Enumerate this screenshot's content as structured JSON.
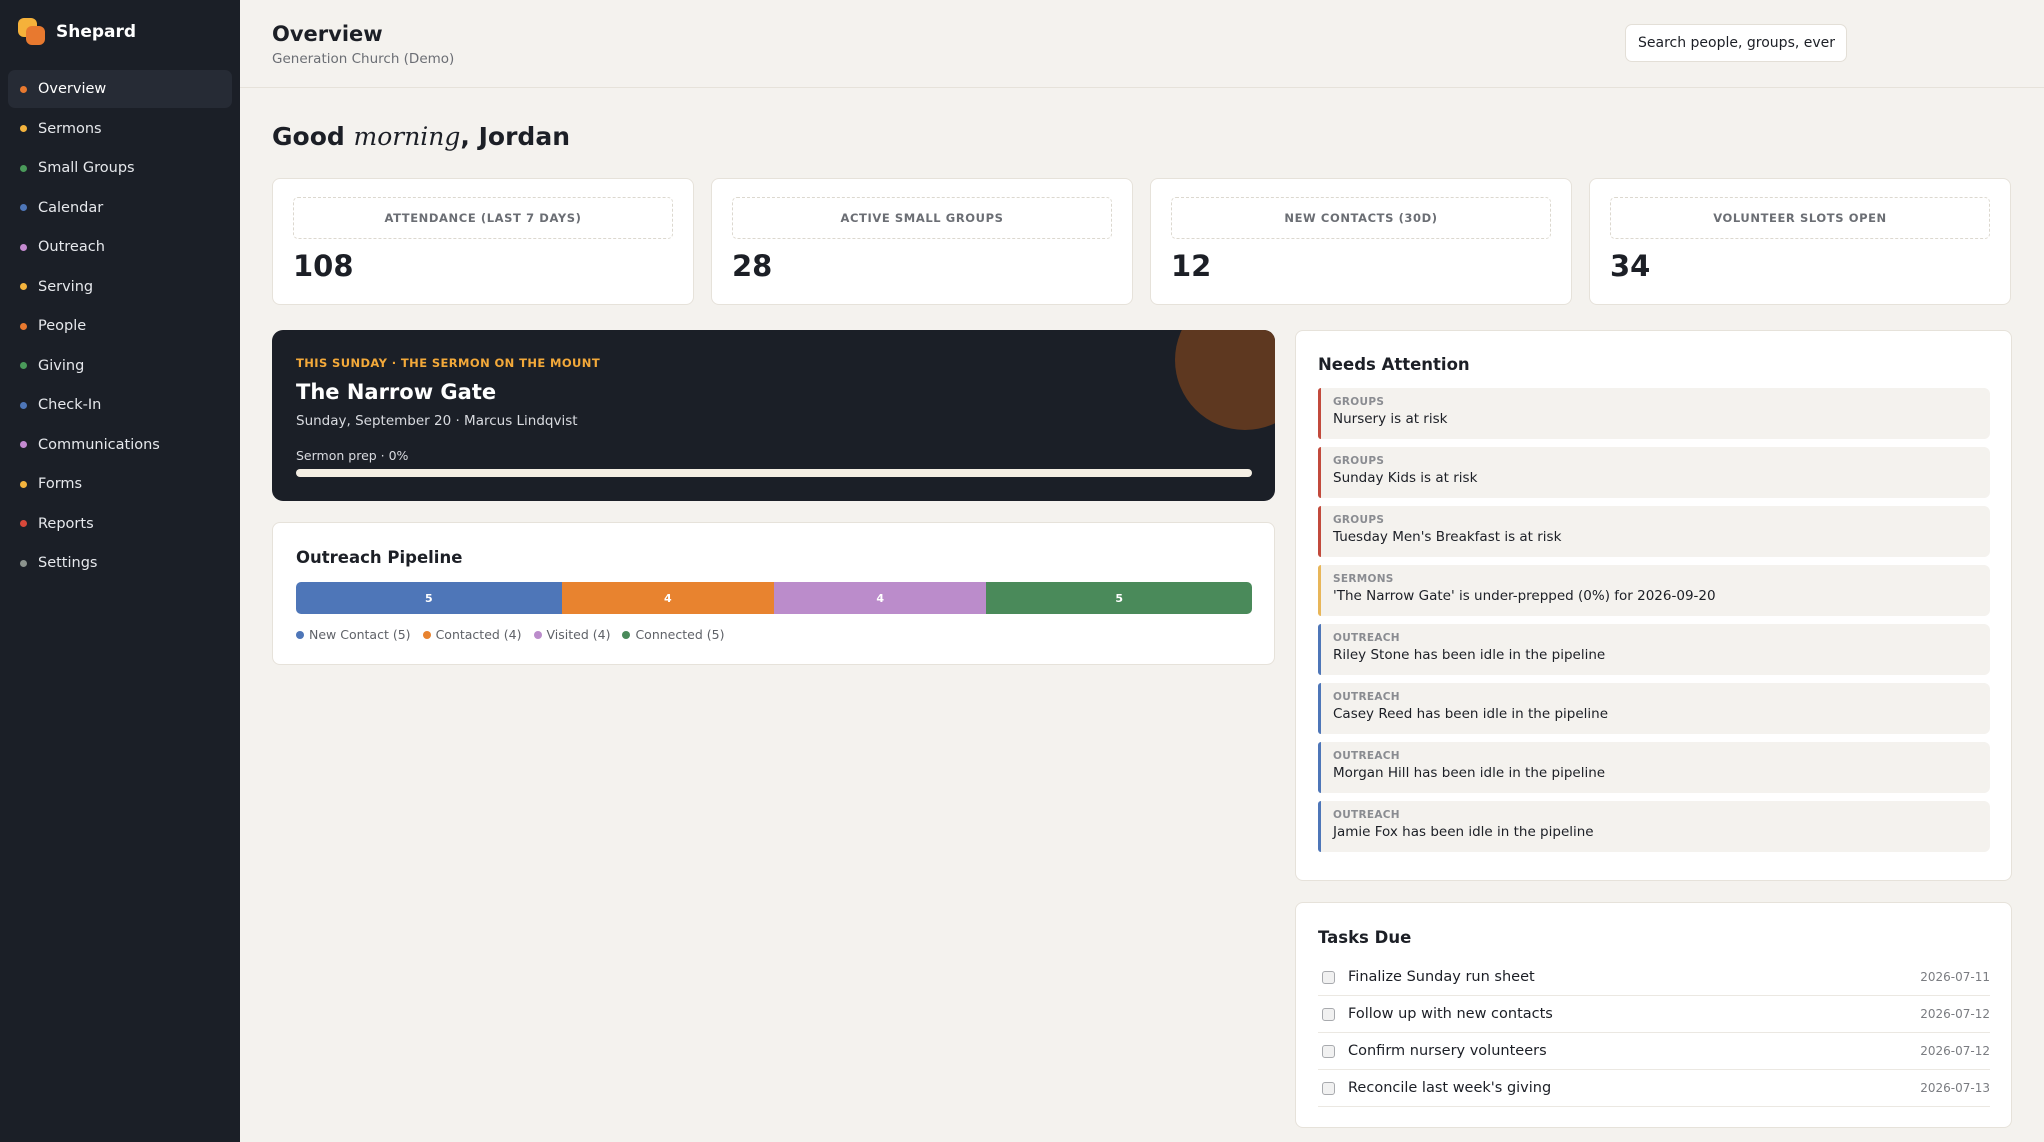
{
  "app": {
    "name": "Shepard"
  },
  "sidebar": {
    "items": [
      {
        "label": "Overview",
        "color": "#e8792f",
        "active": true
      },
      {
        "label": "Sermons",
        "color": "#f3b33d"
      },
      {
        "label": "Small Groups",
        "color": "#4a9a5a"
      },
      {
        "label": "Calendar",
        "color": "#4e76b8"
      },
      {
        "label": "Outreach",
        "color": "#c48ad0"
      },
      {
        "label": "Serving",
        "color": "#f3b33d"
      },
      {
        "label": "People",
        "color": "#e8792f"
      },
      {
        "label": "Giving",
        "color": "#4a9a5a"
      },
      {
        "label": "Check-In",
        "color": "#4e76b8"
      },
      {
        "label": "Communications",
        "color": "#c48ad0"
      },
      {
        "label": "Forms",
        "color": "#f3b33d"
      },
      {
        "label": "Reports",
        "color": "#d8483a"
      },
      {
        "label": "Settings",
        "color": "#8c938e"
      }
    ]
  },
  "header": {
    "title": "Overview",
    "subtitle": "Generation Church (Demo)",
    "search_value": "Search people, groups, ever"
  },
  "greeting": {
    "prefix": "Good",
    "time_of_day": "morning",
    "suffix": ", Jordan"
  },
  "stats": [
    {
      "label": "ATTENDANCE (LAST 7 DAYS)",
      "value": "108"
    },
    {
      "label": "ACTIVE SMALL GROUPS",
      "value": "28"
    },
    {
      "label": "NEW CONTACTS (30D)",
      "value": "12"
    },
    {
      "label": "VOLUNTEER SLOTS OPEN",
      "value": "34"
    }
  ],
  "sermon": {
    "eyebrow": "THIS SUNDAY · THE SERMON ON THE MOUNT",
    "title": "The Narrow Gate",
    "meta": "Sunday, September 20 · Marcus Lindqvist",
    "prep_label": "Sermon prep · 0%",
    "prep_percent": 0
  },
  "pipeline": {
    "title": "Outreach Pipeline",
    "stages": [
      {
        "value": "5",
        "legend": "New Contact (5)",
        "count": 5,
        "color": "#4e76b8"
      },
      {
        "value": "4",
        "legend": "Contacted (4)",
        "count": 4,
        "color": "#e8832f"
      },
      {
        "value": "4",
        "legend": "Visited (4)",
        "count": 4,
        "color": "#bb8ccb"
      },
      {
        "value": "5",
        "legend": "Connected (5)",
        "count": 5,
        "color": "#4a8a5a"
      }
    ]
  },
  "attention": {
    "title": "Needs Attention",
    "items": [
      {
        "category": "GROUPS",
        "text": "Nursery is at risk",
        "color": "#c24a3c"
      },
      {
        "category": "GROUPS",
        "text": "Sunday Kids is at risk",
        "color": "#c24a3c"
      },
      {
        "category": "GROUPS",
        "text": "Tuesday Men's Breakfast is at risk",
        "color": "#c24a3c"
      },
      {
        "category": "SERMONS",
        "text": "'The Narrow Gate' is under-prepped (0%) for 2026-09-20",
        "color": "#e8b659"
      },
      {
        "category": "OUTREACH",
        "text": "Riley Stone has been idle in the pipeline",
        "color": "#4e76b8"
      },
      {
        "category": "OUTREACH",
        "text": "Casey Reed has been idle in the pipeline",
        "color": "#4e76b8"
      },
      {
        "category": "OUTREACH",
        "text": "Morgan Hill has been idle in the pipeline",
        "color": "#4e76b8"
      },
      {
        "category": "OUTREACH",
        "text": "Jamie Fox has been idle in the pipeline",
        "color": "#4e76b8"
      }
    ]
  },
  "tasks": {
    "title": "Tasks Due",
    "items": [
      {
        "label": "Finalize Sunday run sheet",
        "due": "2026-07-11"
      },
      {
        "label": "Follow up with new contacts",
        "due": "2026-07-12"
      },
      {
        "label": "Confirm nursery volunteers",
        "due": "2026-07-12"
      },
      {
        "label": "Reconcile last week's giving",
        "due": "2026-07-13"
      }
    ]
  }
}
